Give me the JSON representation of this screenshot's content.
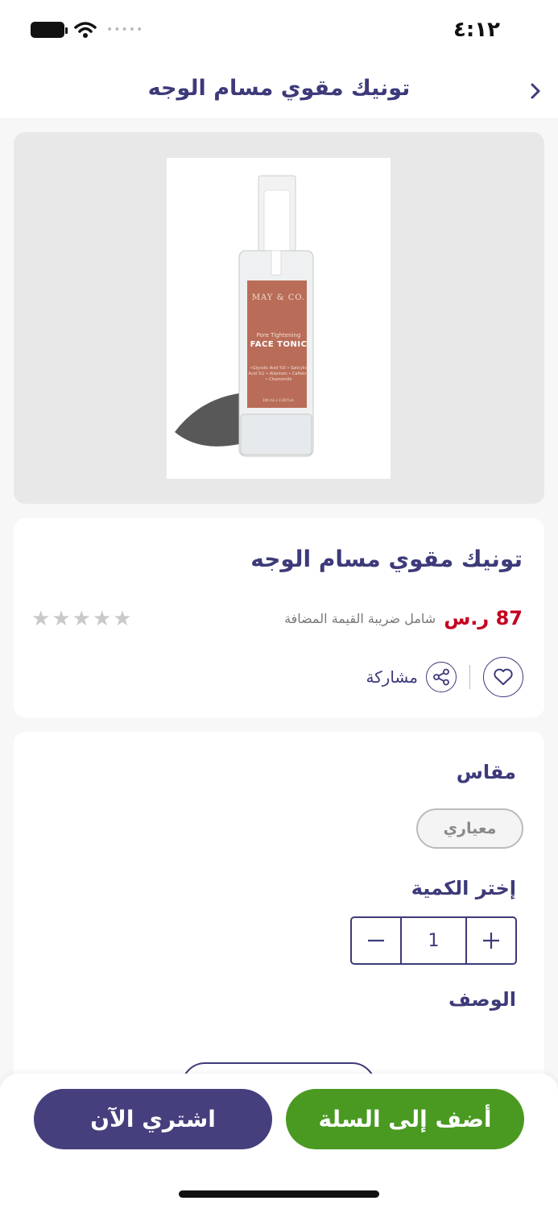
{
  "status_bar": {
    "time": "٤:١٢",
    "signal": "•••••"
  },
  "header": {
    "title": "تونيك مقوي مسام الوجه"
  },
  "product_image": {
    "brand": "MAY & CO.",
    "subtitle": "Pore Tightening",
    "name": "FACE TONIC",
    "ingredients": "•Glycolic Acid %5 • Salicylic Acid %1 • Allantoin • Caffeine • Chamomile",
    "volume": "100 mL e 3.38 fl.oz."
  },
  "product": {
    "title": "تونيك مقوي مسام الوجه",
    "price": "87 ر.س",
    "vat_note": "شامل ضريبة القيمة المضافة",
    "rating": 0,
    "rating_max": 5,
    "share_label": "مشاركة"
  },
  "options": {
    "size_label": "مقاس",
    "size_value": "معياري",
    "quantity_label": "إختر الكمية",
    "quantity": "1",
    "description_label": "الوصف"
  },
  "actions": {
    "buy_now": "اشتري الآن",
    "add_to_cart": "أضف إلى السلة"
  },
  "colors": {
    "primary": "#3d3a7a",
    "price": "#c5001f",
    "cart_green": "#4a9a22",
    "buy_purple": "#463f7d"
  }
}
